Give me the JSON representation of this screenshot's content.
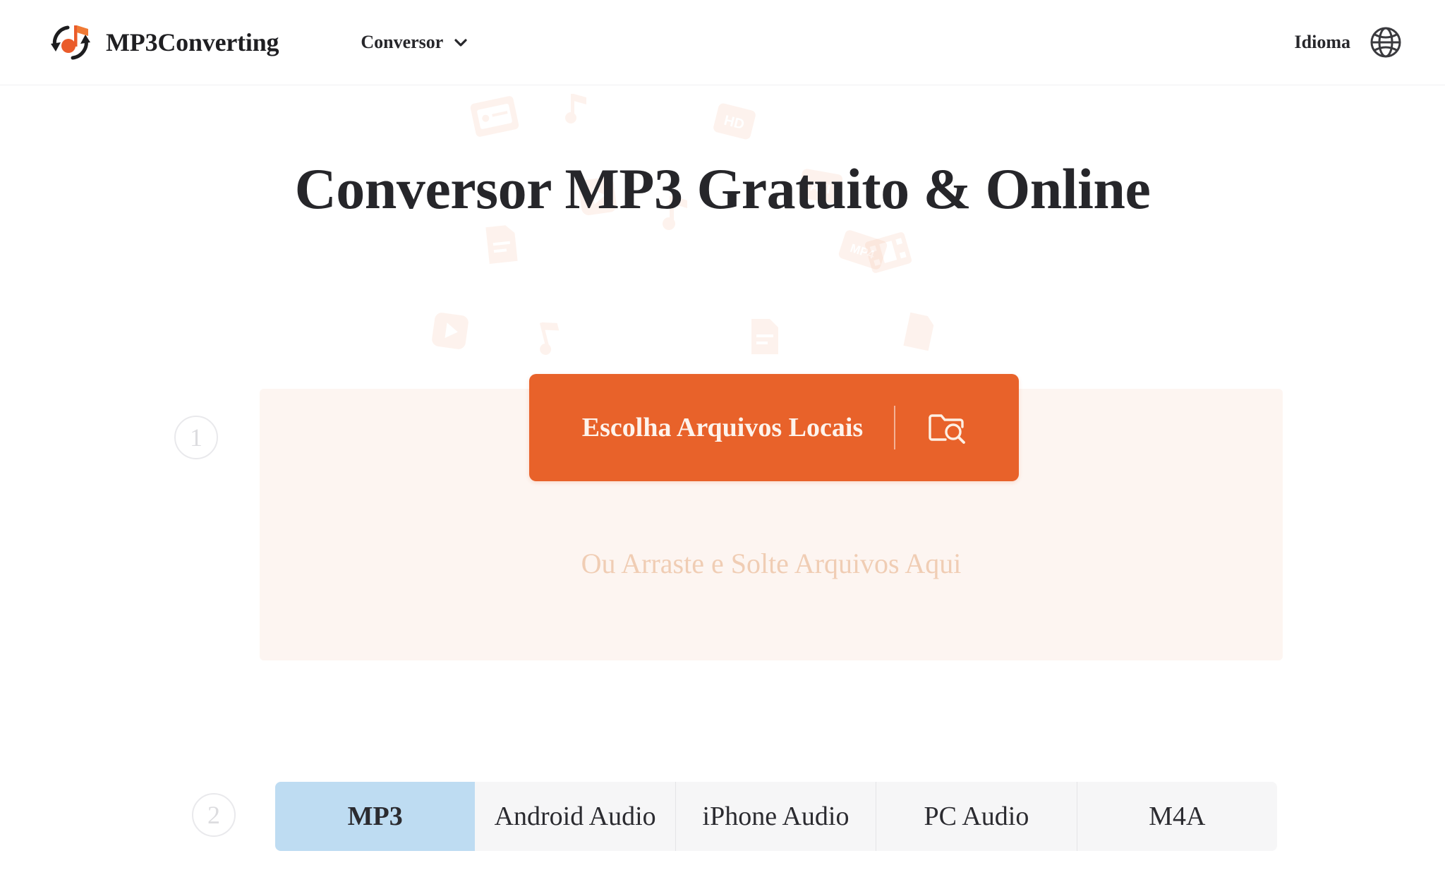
{
  "header": {
    "brand_name": "MP3Converting",
    "logo_icon": "convert-music-note-logo",
    "nav": {
      "label": "Conversor",
      "chevron_icon": "chevron-down-icon"
    },
    "language": {
      "label": "Idioma",
      "globe_icon": "globe-icon"
    }
  },
  "hero": {
    "title": "Conversor MP3 Gratuito & Online"
  },
  "steps": {
    "step1_number": "1",
    "step2_number": "2"
  },
  "upload": {
    "button_label": "Escolha Arquivos Locais",
    "button_icon": "folder-search-icon",
    "drop_hint": "Ou Arraste e Solte Arquivos Aqui"
  },
  "format_tabs": {
    "active_index": 0,
    "items": [
      {
        "label": "MP3"
      },
      {
        "label": "Android Audio"
      },
      {
        "label": "iPhone Audio"
      },
      {
        "label": "PC Audio"
      },
      {
        "label": "M4A"
      }
    ]
  },
  "colors": {
    "accent_orange": "#e8622a",
    "dropzone_bg": "#fdf5f1",
    "drop_hint_text": "#f0cdb4",
    "active_tab_bg": "#bedcf2",
    "tab_bg": "#f6f6f7",
    "heading_text": "#26262a",
    "step_badge_border": "#e9e9ec"
  }
}
